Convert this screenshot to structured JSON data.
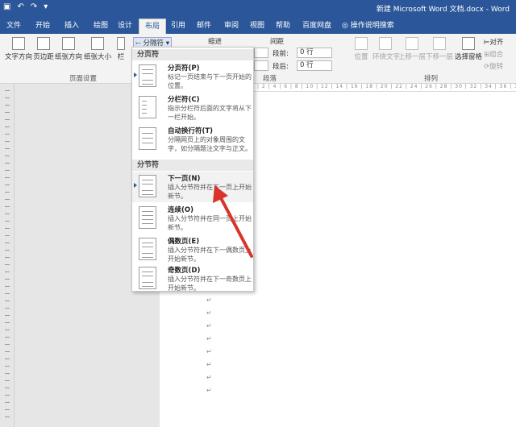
{
  "window": {
    "title": "新建 Microsoft Word 文档.docx - Word"
  },
  "tabs": [
    "文件",
    "开始",
    "插入",
    "绘图",
    "设计",
    "布局",
    "引用",
    "邮件",
    "审阅",
    "视图",
    "帮助",
    "百度网盘"
  ],
  "tell_me": "操作说明搜索",
  "ribbon": {
    "text_direction": "文字方向",
    "margins": "页边距",
    "orientation": "纸张方向",
    "size": "纸张大小",
    "columns": "栏",
    "page_setup": "页面设置",
    "breaks": "分隔符",
    "indent": "缩进",
    "spacing": "间距",
    "before": "段前:",
    "after": "段后:",
    "before_value": "0 行",
    "after_value": "0 行",
    "paragraph": "段落",
    "position": "位置",
    "wrap": "环绕文字",
    "forward": "上移一层",
    "backward": "下移一层",
    "selection_pane": "选择窗格",
    "align": "对齐",
    "group": "组合",
    "rotate": "旋转",
    "arrange": "排列"
  },
  "dropdown": {
    "page_breaks_header": "分页符",
    "section_breaks_header": "分节符",
    "items": [
      {
        "title": "分页符(P)",
        "desc": "标记一页结束与下一页开始的位置。"
      },
      {
        "title": "分栏符(C)",
        "desc": "指示分栏符后面的文字将从下一栏开始。"
      },
      {
        "title": "自动换行符(T)",
        "desc": "分隔网页上的对象周围的文字，如分隔题注文字与正文。"
      },
      {
        "title": "下一页(N)",
        "desc": "插入分节符并在下一页上开始新节。"
      },
      {
        "title": "连续(O)",
        "desc": "插入分节符并在同一页上开始新节。"
      },
      {
        "title": "偶数页(E)",
        "desc": "插入分节符并在下一偶数页上开始新节。"
      },
      {
        "title": "奇数页(D)",
        "desc": "插入分节符并在下一奇数页上开始新节。"
      }
    ]
  },
  "document": {
    "paragraph_mark": "↵"
  }
}
